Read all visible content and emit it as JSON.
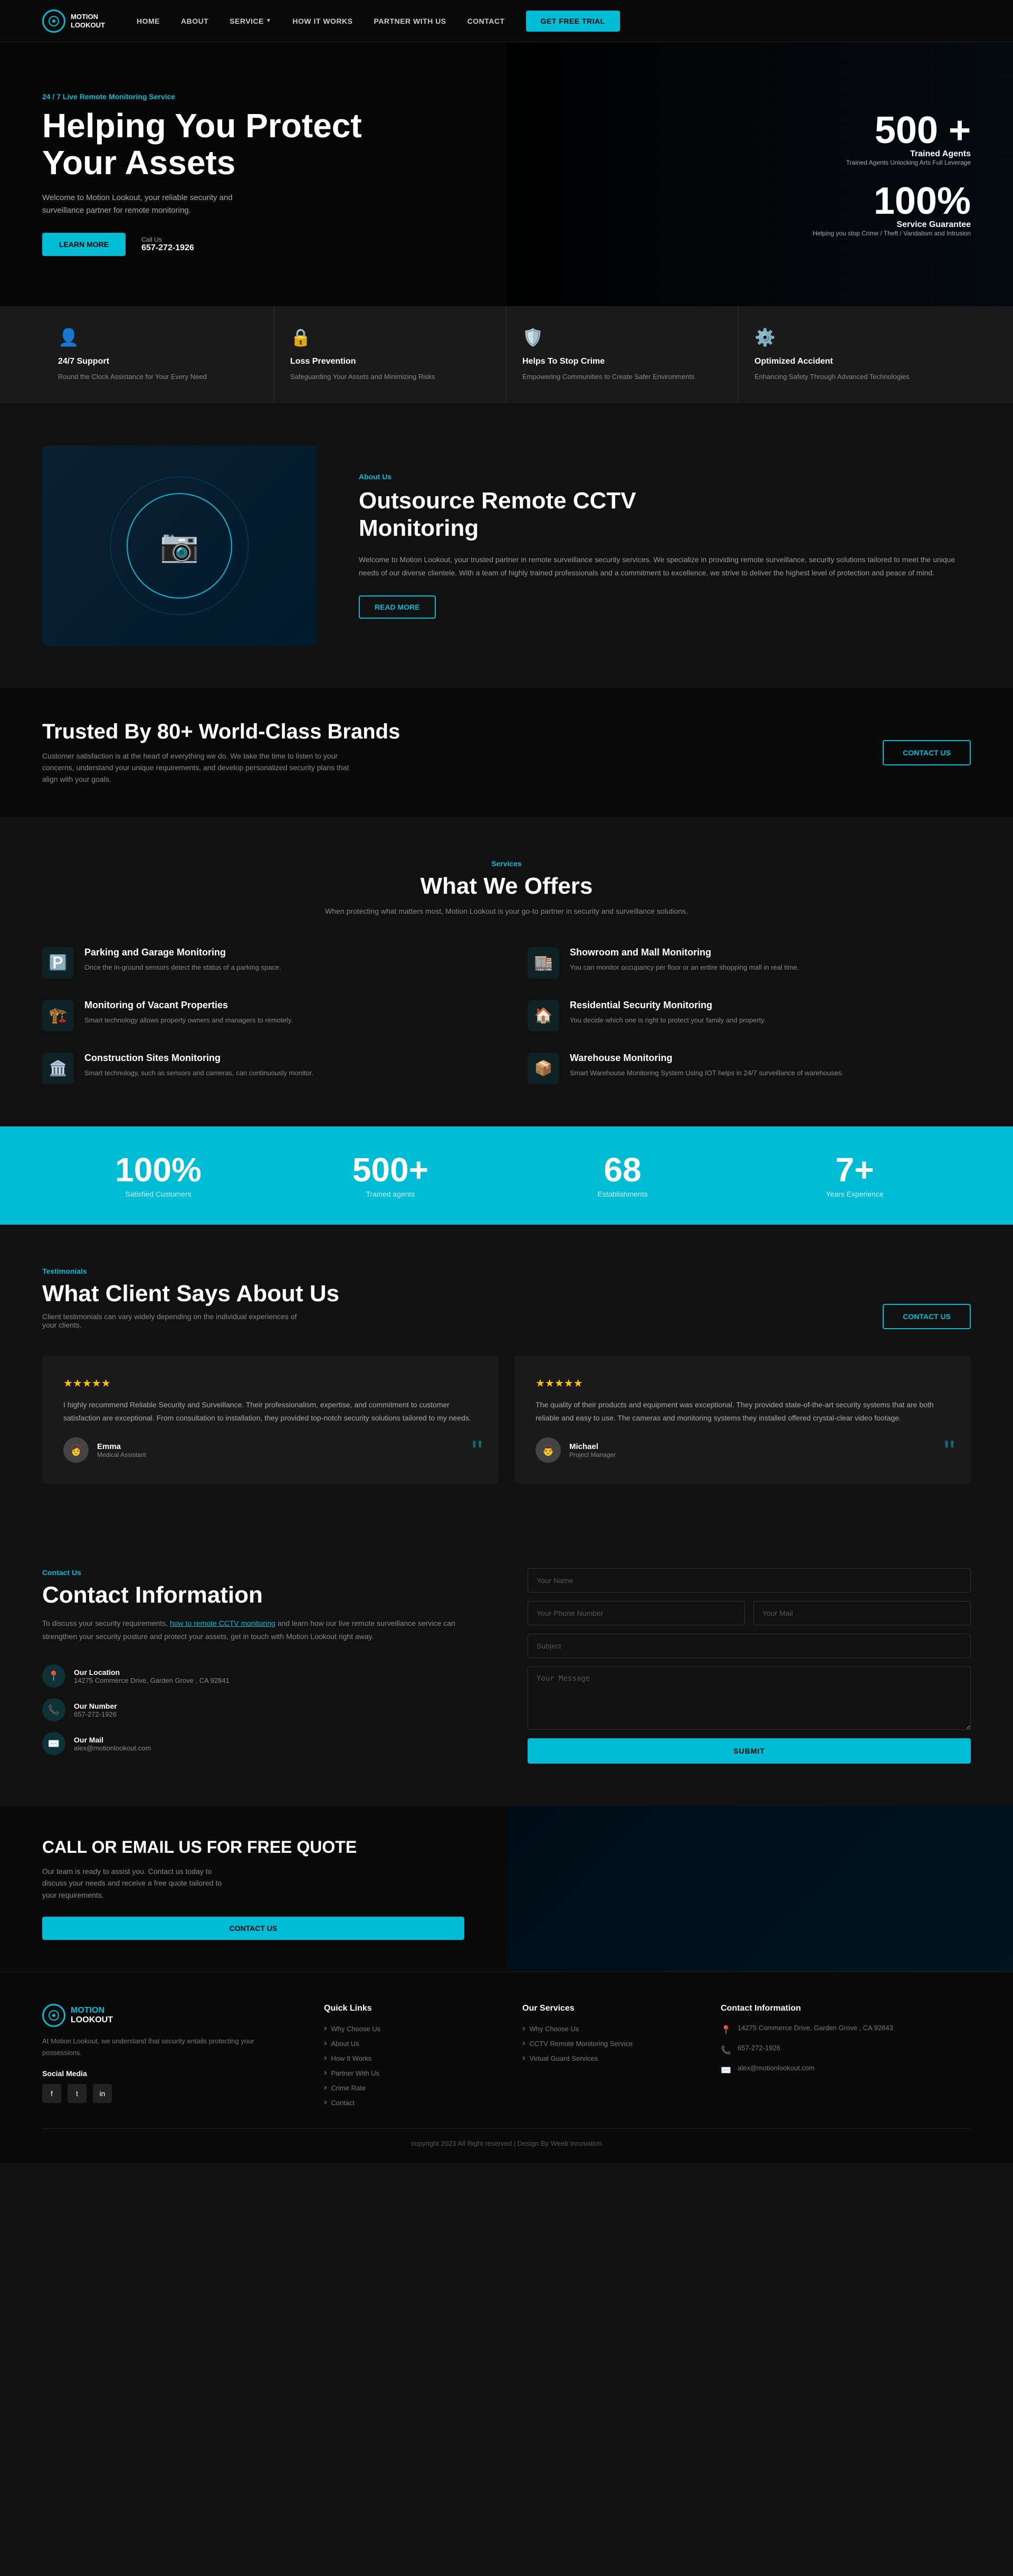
{
  "nav": {
    "logo_name": "MOTION",
    "logo_sub": "LOOKOUT",
    "links": [
      {
        "label": "HOME",
        "id": "home"
      },
      {
        "label": "ABOUT",
        "id": "about"
      },
      {
        "label": "SERVICE",
        "id": "service",
        "has_dropdown": true
      },
      {
        "label": "HOW IT WORKS",
        "id": "how-it-works"
      },
      {
        "label": "PARTNER WITH US",
        "id": "partner"
      },
      {
        "label": "CONTACT",
        "id": "contact"
      }
    ],
    "cta": "GET FREE TRIAL"
  },
  "hero": {
    "tag": "24 / 7 Live Remote Monitoring Service",
    "title_line1": "Helping You Protect",
    "title_line2": "Your Assets",
    "desc": "Welcome to Motion Lookout, your reliable security and surveillance partner for remote monitoring.",
    "learn_more": "LEARN MORE",
    "call_label": "Call Us",
    "phone": "657-272-1926",
    "stat1_num": "500 +",
    "stat1_label": "Trained Agents",
    "stat1_sub": "Trained Agents Unlocking Arts Full Leverage",
    "stat2_num": "100%",
    "stat2_label": "Service Guarantee",
    "stat2_sub": "Helping you stop Crime / Theft / Vandalism and Intrusion"
  },
  "features": [
    {
      "icon": "👤",
      "title": "24/7 Support",
      "desc": "Round the Clock Assistance for Your Every Need"
    },
    {
      "icon": "🔒",
      "title": "Loss Prevention",
      "desc": "Safeguarding Your Assets and Minimizing Risks"
    },
    {
      "icon": "🛡️",
      "title": "Helps To Stop Crime",
      "desc": "Empowering Communities to Create Safer Environments"
    },
    {
      "icon": "⚙️",
      "title": "Optimized Accident",
      "desc": "Enhancing Safety Through Advanced Technologies"
    }
  ],
  "about": {
    "tag": "About Us",
    "title_line1": "Outsource Remote CCTV",
    "title_line2": "Monitoring",
    "desc": "Welcome to Motion Lookout, your trusted partner in remote surveillance security services. We specialize in providing remote surveillance, security solutions tailored to meet the unique needs of our diverse clientele. With a team of highly trained professionals and a commitment to excellence, we strive to deliver the highest level of protection and peace of mind.",
    "read_more": "READ MORE"
  },
  "trusted": {
    "title": "Trusted By 80+ World-Class Brands",
    "desc": "Customer satisfaction is at the heart of everything we do. We take the time to listen to your concerns, understand your unique requirements, and develop personalized security plans that align with your goals.",
    "cta": "CONTACT US"
  },
  "services": {
    "tag": "Services",
    "title": "What We Offers",
    "desc": "When protecting what matters most, Motion Lookout is your go-to partner in security and surveillance solutions.",
    "items": [
      {
        "icon": "🅿️",
        "title": "Parking and Garage Monitoring",
        "desc": "Once the in-ground sensors detect the status of a parking space."
      },
      {
        "icon": "🏬",
        "title": "Showroom and Mall Monitoring",
        "desc": "You can monitor occupancy per floor or an entire shopping mall in real time."
      },
      {
        "icon": "🏗️",
        "title": "Monitoring of Vacant Properties",
        "desc": "Smart technology allows property owners and managers to remotely."
      },
      {
        "icon": "🏠",
        "title": "Residential Security Monitoring",
        "desc": "You decide which one is right to protect your family and property."
      },
      {
        "icon": "🏛️",
        "title": "Construction Sites Monitoring",
        "desc": "Smart technology, such as sensors and cameras, can continuously monitor."
      },
      {
        "icon": "📦",
        "title": "Warehouse Monitoring",
        "desc": "Smart Warehouse Monitoring System Using IOT helps in 24/7 surveillance of warehouses."
      }
    ]
  },
  "stats_bar": [
    {
      "num": "100%",
      "label": "Satisfied Customers"
    },
    {
      "num": "500+",
      "label": "Trained agents"
    },
    {
      "num": "68",
      "label": "Establishments"
    },
    {
      "num": "7+",
      "label": "Years Experience"
    }
  ],
  "testimonials": {
    "tag": "Testimonials",
    "title": "What Client Says About Us",
    "desc": "Client testimonials can vary widely depending on the individual experiences of your clients.",
    "cta": "CONTACT US",
    "items": [
      {
        "stars": "★★★★★",
        "text": "I highly recommend Reliable Security and Surveillance. Their professionalism, expertise, and commitment to customer satisfaction are exceptional. From consultation to installation, they provided top-notch security solutions tailored to my needs.",
        "name": "Emma",
        "role": "Medical Assistant"
      },
      {
        "stars": "★★★★★",
        "text": "The quality of their products and equipment was exceptional. They provided state-of-the-art security systems that are both reliable and easy to use. The cameras and monitoring systems they installed offered crystal-clear video footage.",
        "name": "Michael",
        "role": "Project Manager"
      }
    ]
  },
  "contact": {
    "tag": "Contact Us",
    "title": "Contact Information",
    "desc_before": "To discuss your security requirements, ",
    "desc_link": "how to remote CCTV monitoring",
    "desc_after": " and learn how our live remote surveillance service can strengthen your security posture and protect your assets, get in touch with Motion Lookout right away.",
    "info_items": [
      {
        "icon": "📍",
        "label": "Our Location",
        "value": "14275 Commerce Drive, Garden Grove , CA 92841"
      },
      {
        "icon": "📞",
        "label": "Our Number",
        "value": "657-272-1926"
      },
      {
        "icon": "✉️",
        "label": "Our Mail",
        "value": "alex@motionlookout.com"
      }
    ],
    "form": {
      "name_placeholder": "Your Name",
      "phone_placeholder": "Your Phone Number",
      "mail_placeholder": "Your Mail",
      "subject_placeholder": "Subject",
      "message_placeholder": "Your Message",
      "submit": "SUBMIT"
    }
  },
  "cta_section": {
    "title": "CALL OR EMAIL US FOR FREE QUOTE",
    "desc": "Our team is ready to assist you. Contact us today to discuss your needs and receive a free quote tailored to your requirements.",
    "cta": "CONTACT US"
  },
  "footer": {
    "logo_name": "MOTION",
    "logo_sub": "LOOKOUT",
    "about_desc": "At Motion Lookout, we understand that security entails protecting your possessions.",
    "social_label": "Social Media",
    "social_icons": [
      "f",
      "t",
      "in"
    ],
    "quick_links": {
      "title": "Quick Links",
      "items": [
        "Why Choose Us",
        "About Us",
        "How It Works",
        "Partner With Us",
        "Crime Rate",
        "Contact"
      ]
    },
    "services_col": {
      "title": "Our Services",
      "items": [
        "Why Choose Us",
        "CCTV Remote Monitoring Service",
        "Virtual Guard Services"
      ]
    },
    "contact_col": {
      "title": "Contact Information",
      "items": [
        {
          "icon": "📍",
          "text": "14275 Commerce Drive, Garden Grove , CA 92843"
        },
        {
          "icon": "📞",
          "text": "657-272-1926"
        },
        {
          "icon": "✉️",
          "text": "alex@motionlookout.com"
        }
      ]
    },
    "copyright": "copyright 2023 All Right reserved | Design By Weeb Innovation"
  }
}
